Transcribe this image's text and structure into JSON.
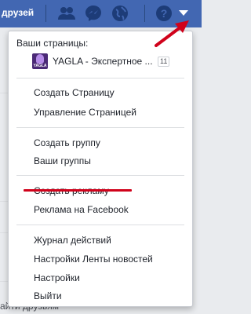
{
  "topbar": {
    "friends_text": "друзей",
    "icons": [
      "friends-icon",
      "messenger-icon",
      "globe-icon",
      "help-icon",
      "caret-down-icon"
    ],
    "color": "#4267b2"
  },
  "background": {
    "bottom_text": "айти друзьям"
  },
  "menu": {
    "pages_header": "Ваши страницы:",
    "page": {
      "name": "YAGLA - Экспертное ...",
      "count": "11",
      "avatar_text": "YAGLA"
    },
    "groups": [
      {
        "items": [
          "Создать Страницу",
          "Управление Страницей"
        ]
      },
      {
        "items": [
          "Создать группу",
          "Ваши группы"
        ]
      },
      {
        "items": [
          "Создать рекламу",
          "Реклама на Facebook"
        ]
      },
      {
        "items": [
          "Журнал действий",
          "Настройки Ленты новостей",
          "Настройки",
          "Выйти"
        ]
      }
    ],
    "highlight_color": "#d0021b"
  }
}
